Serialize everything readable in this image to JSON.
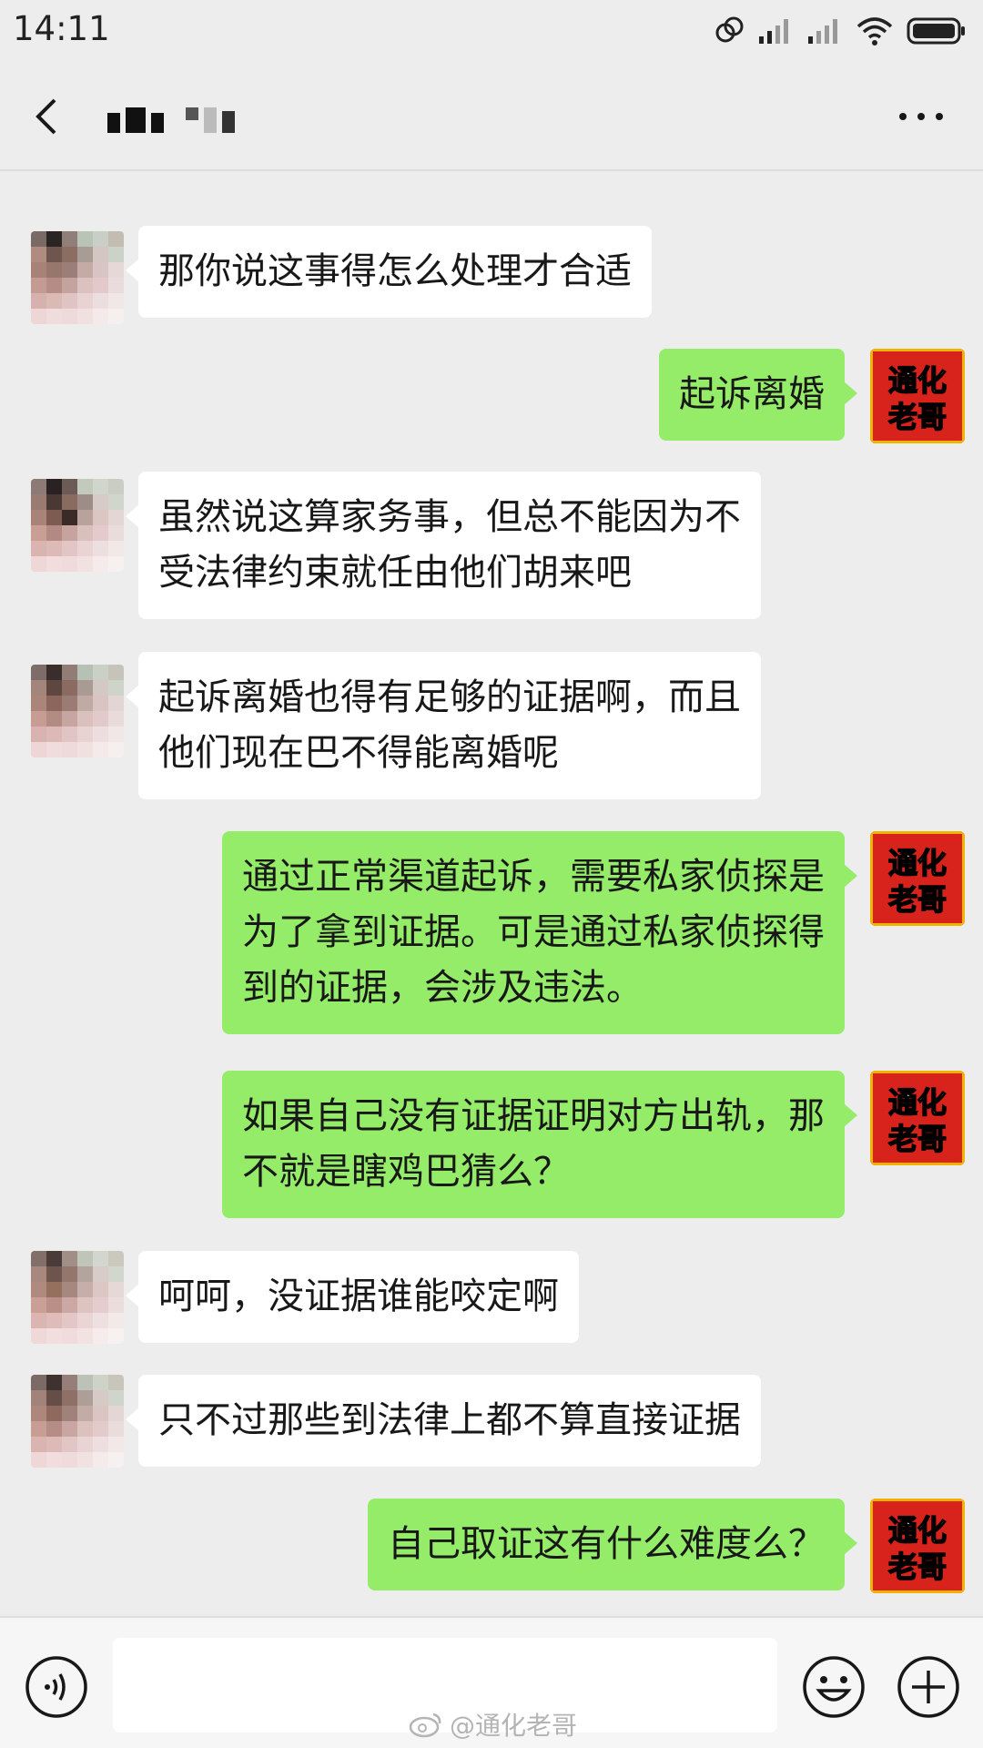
{
  "status_bar": {
    "time": "14:11"
  },
  "header": {
    "back_icon": "back-chevron-icon",
    "more_icon": "more-dots-icon"
  },
  "messages": [
    {
      "side": "left",
      "text": "那你说这事得怎么处理才合适"
    },
    {
      "side": "right",
      "text": "起诉离婚"
    },
    {
      "side": "left",
      "text": "虽然说这算家务事，但总不能因为不\n受法律约束就任由他们胡来吧"
    },
    {
      "side": "left",
      "text": "起诉离婚也得有足够的证据啊，而且\n他们现在巴不得能离婚呢"
    },
    {
      "side": "right",
      "text": "通过正常渠道起诉，需要私家侦探是\n为了拿到证据。可是通过私家侦探得\n到的证据，会涉及违法。"
    },
    {
      "side": "right",
      "text": "如果自己没有证据证明对方出轨，那\n不就是瞎鸡巴猜么？"
    },
    {
      "side": "left",
      "text": "呵呵，没证据谁能咬定啊"
    },
    {
      "side": "left",
      "text": "只不过那些到法律上都不算直接证据"
    },
    {
      "side": "right",
      "text": "自己取证这有什么难度么？"
    }
  ],
  "my_avatar": {
    "line1": "通化",
    "line2": "老哥",
    "color_bg": "#d8231c",
    "color_text": "#ffffff"
  },
  "input_bar": {
    "input_value": "",
    "voice_icon": "voice-icon",
    "emoji_icon": "emoji-icon",
    "plus_icon": "plus-icon"
  },
  "watermark": {
    "text": "@通化老哥"
  },
  "colors": {
    "background": "#ededed",
    "bubble_me": "#95ec69",
    "bubble_other": "#ffffff"
  }
}
